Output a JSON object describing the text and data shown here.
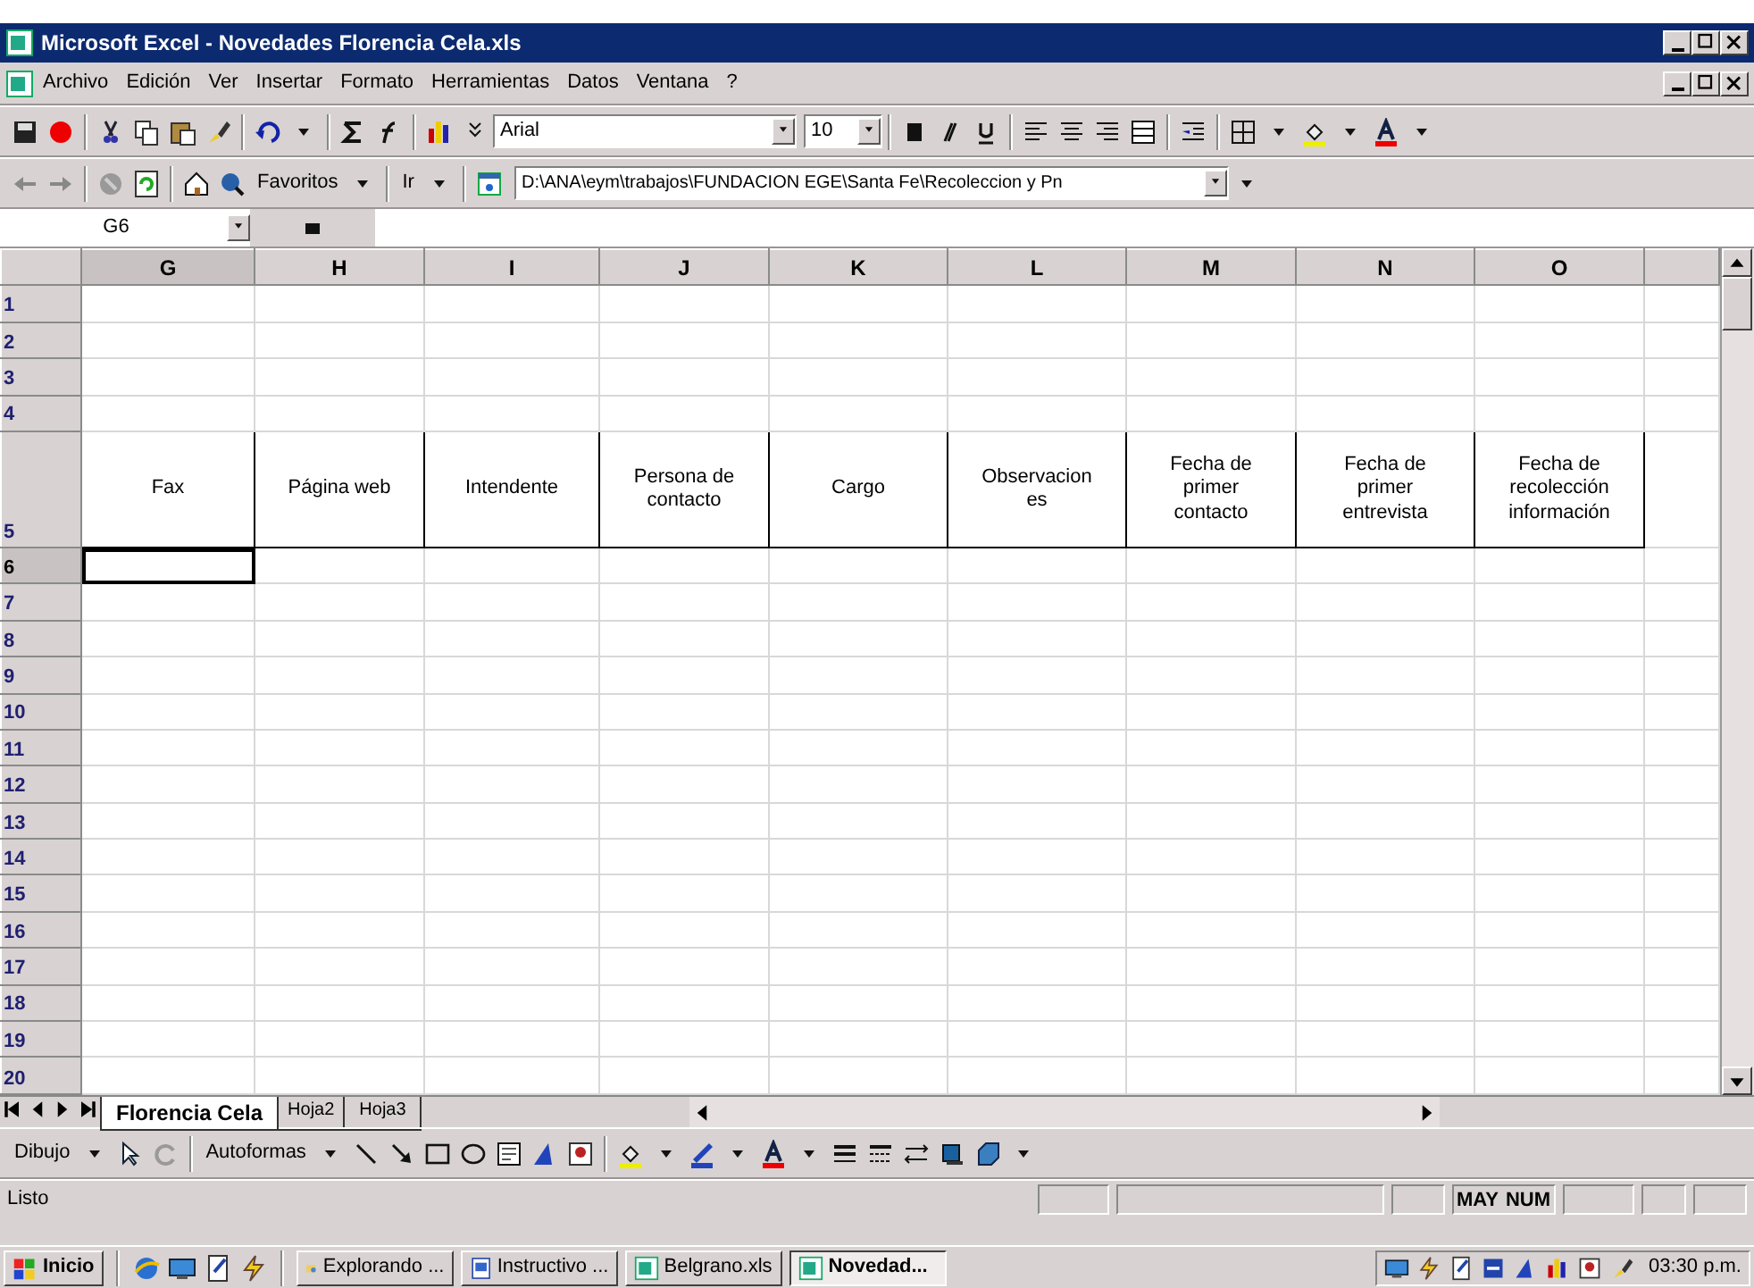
{
  "window": {
    "title": "Microsoft Excel - Novedades Florencia Cela.xls"
  },
  "menu": [
    "Archivo",
    "Edición",
    "Ver",
    "Insertar",
    "Formato",
    "Herramientas",
    "Datos",
    "Ventana",
    "?"
  ],
  "format_toolbar": {
    "font": "Arial",
    "size": "10"
  },
  "web_toolbar": {
    "favorites": "Favoritos",
    "go": "Ir",
    "address": "D:\\ANA\\eym\\trabajos\\FUNDACION EGE\\Santa Fe\\Recoleccion y Pn"
  },
  "name_box": "G6",
  "columns": [
    {
      "label": "G",
      "selected": true
    },
    {
      "label": "H",
      "selected": false
    },
    {
      "label": "I",
      "selected": false
    },
    {
      "label": "J",
      "selected": false
    },
    {
      "label": "K",
      "selected": false
    },
    {
      "label": "L",
      "selected": false
    },
    {
      "label": "M",
      "selected": false
    },
    {
      "label": "N",
      "selected": false
    },
    {
      "label": "O",
      "selected": false
    }
  ],
  "rows": [
    {
      "label": "1",
      "selected": false
    },
    {
      "label": "2",
      "selected": false
    },
    {
      "label": "3",
      "selected": false
    },
    {
      "label": "4",
      "selected": false
    },
    {
      "label": "5",
      "selected": false
    },
    {
      "label": "6",
      "selected": true
    },
    {
      "label": "7",
      "selected": false
    },
    {
      "label": "8",
      "selected": false
    },
    {
      "label": "9",
      "selected": false
    },
    {
      "label": "10",
      "selected": false
    },
    {
      "label": "11",
      "selected": false
    },
    {
      "label": "12",
      "selected": false
    },
    {
      "label": "13",
      "selected": false
    },
    {
      "label": "14",
      "selected": false
    },
    {
      "label": "15",
      "selected": false
    },
    {
      "label": "16",
      "selected": false
    },
    {
      "label": "17",
      "selected": false
    },
    {
      "label": "18",
      "selected": false
    },
    {
      "label": "19",
      "selected": false
    },
    {
      "label": "20",
      "selected": false
    }
  ],
  "header_cells": [
    "Fax",
    "Página web",
    "Intendente",
    "Persona de\ncontacto",
    "Cargo",
    "Observacion\nes",
    "Fecha de\nprimer\ncontacto",
    "Fecha de\nprimer\nentrevista",
    "Fecha de\nrecolección\ninformación"
  ],
  "sheet_tabs": [
    {
      "label": "Florencia Cela",
      "selected": true
    },
    {
      "label": "Hoja2",
      "selected": false
    },
    {
      "label": "Hoja3",
      "selected": false
    }
  ],
  "drawing_toolbar": {
    "draw": "Dibujo",
    "autoshapes": "Autoformas"
  },
  "status_bar": {
    "text": "Listo",
    "indicators": [
      "MAY",
      "NUM"
    ]
  },
  "taskbar": {
    "start": "Inicio",
    "buttons": [
      {
        "label": "Explorando ...",
        "selected": false
      },
      {
        "label": "Instructivo ...",
        "selected": false
      },
      {
        "label": "Belgrano.xls",
        "selected": false
      },
      {
        "label": "Novedad...",
        "selected": true
      }
    ],
    "clock": "03:30 p.m."
  }
}
